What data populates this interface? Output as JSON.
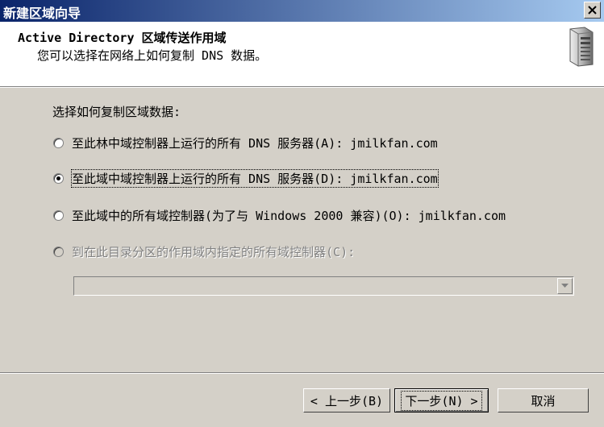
{
  "window": {
    "title": "新建区域向导"
  },
  "header": {
    "title": "Active Directory 区域传送作用域",
    "subtitle": "您可以选择在网络上如何复制 DNS 数据。"
  },
  "content": {
    "prompt": "选择如何复制区域数据:",
    "options": [
      {
        "label": "至此林中域控制器上运行的所有 DNS 服务器(A): jmilkfan.com",
        "selected": false,
        "enabled": true
      },
      {
        "label": "至此域中域控制器上运行的所有 DNS 服务器(D): jmilkfan.com",
        "selected": true,
        "enabled": true
      },
      {
        "label": "至此域中的所有域控制器(为了与 Windows 2000 兼容)(O): jmilkfan.com",
        "selected": false,
        "enabled": true
      },
      {
        "label": "到在此目录分区的作用域内指定的所有域控制器(C):",
        "selected": false,
        "enabled": false
      }
    ],
    "partition_combo": {
      "value": "",
      "enabled": false
    }
  },
  "footer": {
    "back_label": "< 上一步(B)",
    "next_label": "下一步(N) >",
    "cancel_label": "取消"
  },
  "icons": {
    "close": "close-icon",
    "server": "server-icon",
    "dropdown": "chevron-down-icon"
  },
  "colors": {
    "title_gradient_start": "#0a246a",
    "title_gradient_end": "#a6caf0",
    "dialog_bg": "#d4d0c8",
    "header_bg": "#ffffff"
  }
}
